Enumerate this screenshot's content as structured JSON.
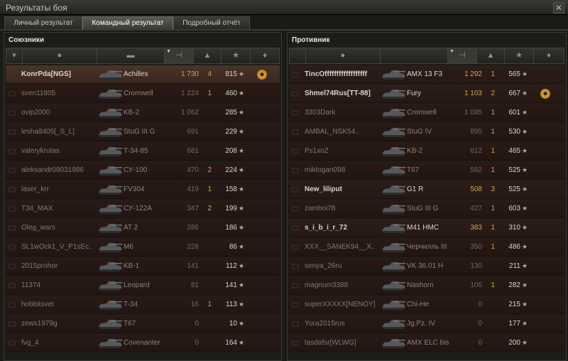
{
  "window": {
    "title": "Результаты боя",
    "close_glyph": "✕"
  },
  "tabs": [
    "Личный результат",
    "Командный результат",
    "Подробный отчёт"
  ],
  "allies": {
    "title": "Союзники",
    "rows": [
      {
        "name": "KonrPda[NGS]",
        "vehicle": "Achilles",
        "damage": "1 730",
        "kills": "4",
        "exp": "815",
        "medal": true,
        "me": true,
        "alive": true
      },
      {
        "name": "sven11805",
        "vehicle": "Cromwell",
        "damage": "1 224",
        "kills": "1",
        "exp": "460"
      },
      {
        "name": "ovip2000",
        "vehicle": "KB-2",
        "damage": "1 062",
        "kills": "",
        "exp": "285"
      },
      {
        "name": "lesha8405[_S_L]",
        "vehicle": "StuG III G",
        "damage": "691",
        "kills": "",
        "exp": "229"
      },
      {
        "name": "valerykrutas",
        "vehicle": "T-34-85",
        "damage": "681",
        "kills": "",
        "exp": "208"
      },
      {
        "name": "aleksandr09031986",
        "vehicle": "СУ-100",
        "damage": "470",
        "kills": "2",
        "exp": "224"
      },
      {
        "name": "laser_krr",
        "vehicle": "FV304",
        "damage": "419",
        "kills": "1",
        "exp": "158"
      },
      {
        "name": "T34_MAX",
        "vehicle": "СУ-122А",
        "damage": "347",
        "kills": "2",
        "exp": "199"
      },
      {
        "name": "Oleg_wars",
        "vehicle": "AT 2",
        "damage": "286",
        "kills": "",
        "exp": "186"
      },
      {
        "name": "SL1wOck1_V_P1sEc..",
        "vehicle": "M6",
        "damage": "228",
        "kills": "",
        "exp": "86"
      },
      {
        "name": "2015prohor",
        "vehicle": "KB-1",
        "damage": "141",
        "kills": "",
        "exp": "112"
      },
      {
        "name": "11374",
        "vehicle": "Leopard",
        "damage": "81",
        "kills": "",
        "exp": "141"
      },
      {
        "name": "hobbitsvet",
        "vehicle": "T-34",
        "damage": "16",
        "kills": "1",
        "exp": "113"
      },
      {
        "name": "zews1979g",
        "vehicle": "T67",
        "damage": "0",
        "kills": "",
        "exp": "10"
      },
      {
        "name": "fvg_4",
        "vehicle": "Covenanter",
        "damage": "0",
        "kills": "",
        "exp": "164"
      }
    ]
  },
  "enemies": {
    "title": "Противник",
    "rows": [
      {
        "name": "TincOffffffffffffffffff",
        "vehicle": "AMX 13 F3",
        "damage": "1 292",
        "kills": "1",
        "exp": "565",
        "alive": true
      },
      {
        "name": "Shmel74Rus[TT-88]",
        "vehicle": "Fury",
        "damage": "1 103",
        "kills": "2",
        "exp": "667",
        "medal": true,
        "alive": true
      },
      {
        "name": "3303Dark",
        "vehicle": "Cromwell",
        "damage": "1 085",
        "kills": "1",
        "exp": "601"
      },
      {
        "name": "AMBAL_NSK54..",
        "vehicle": "StuG IV",
        "damage": "895",
        "kills": "1",
        "exp": "530"
      },
      {
        "name": "Ps1xoZ",
        "vehicle": "KB-2",
        "damage": "612",
        "kills": "1",
        "exp": "465"
      },
      {
        "name": "miktogan098",
        "vehicle": "T67",
        "damage": "582",
        "kills": "1",
        "exp": "525"
      },
      {
        "name": "New_liliput",
        "vehicle": "G1 R",
        "damage": "508",
        "kills": "3",
        "exp": "525",
        "alive": true
      },
      {
        "name": "zamboi78",
        "vehicle": "StuG III G",
        "damage": "427",
        "kills": "1",
        "exp": "603"
      },
      {
        "name": "s_i_b_i_r_72",
        "vehicle": "M41 HMC",
        "damage": "383",
        "kills": "1",
        "exp": "310",
        "alive": true
      },
      {
        "name": "XXX__SANEK94__X..",
        "vehicle": "Черчилль III",
        "damage": "350",
        "kills": "1",
        "exp": "486"
      },
      {
        "name": "senya_26ru",
        "vehicle": "VK 36.01 H",
        "damage": "130",
        "kills": "",
        "exp": "211"
      },
      {
        "name": "magnum3388",
        "vehicle": "Nashorn",
        "damage": "106",
        "kills": "1",
        "exp": "282"
      },
      {
        "name": "superXXXXX[NENOY]",
        "vehicle": "Chi-He",
        "damage": "0",
        "kills": "",
        "exp": "215"
      },
      {
        "name": "Yura2015rus",
        "vehicle": "Jg.Pz. IV",
        "damage": "0",
        "kills": "",
        "exp": "177"
      },
      {
        "name": "tasdafsr[WLWG]",
        "vehicle": "AMX ELC bis",
        "damage": "0",
        "kills": "",
        "exp": "200"
      }
    ]
  },
  "star_glyph": "★",
  "medal_glyph": "✸",
  "header_icons": [
    "squad-icon",
    "player-icon",
    "tank-icon",
    "damage-icon",
    "kills-icon",
    "experience-icon",
    "medal-icon"
  ]
}
